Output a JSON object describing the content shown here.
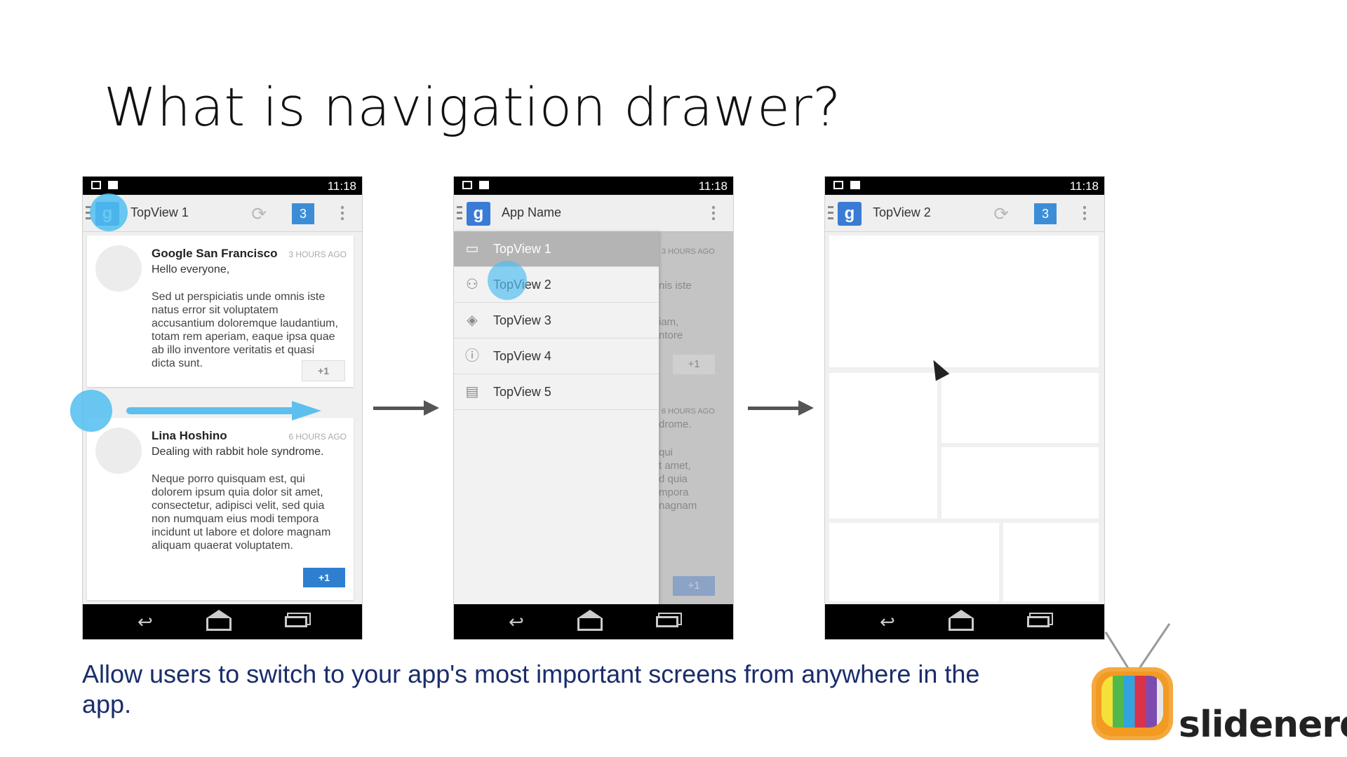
{
  "slide": {
    "title": "What is navigation drawer?",
    "caption": "Allow users to switch to your app's most important screens from anywhere in the app.",
    "brand": "slidenerd"
  },
  "status_time": "11:18",
  "screen1": {
    "title": "TopView 1",
    "badge": "3",
    "posts": [
      {
        "name": "Google San Francisco",
        "time": "3 HOURS AGO",
        "lead": "Hello everyone,",
        "body": "Sed ut perspiciatis unde omnis iste natus error sit voluptatem accusantium doloremque laudantium, totam rem aperiam, eaque ipsa quae ab illo inventore veritatis et quasi dicta sunt.",
        "plus": "+1"
      },
      {
        "name": "Lina Hoshino",
        "time": "6 HOURS AGO",
        "lead": "Dealing with rabbit hole syndrome.",
        "body": "Neque porro quisquam est, qui dolorem ipsum quia dolor sit amet, consectetur, adipisci velit, sed quia non numquam eius modi tempora incidunt ut labore et dolore magnam aliquam quaerat voluptatem.",
        "plus": "+1"
      }
    ]
  },
  "screen2": {
    "title": "App Name",
    "drawer_items": [
      {
        "label": "TopView 1",
        "icon": "inbox-icon"
      },
      {
        "label": "TopView 2",
        "icon": "people-icon"
      },
      {
        "label": "TopView 3",
        "icon": "tag-icon"
      },
      {
        "label": "TopView 4",
        "icon": "info-icon"
      },
      {
        "label": "TopView 5",
        "icon": "chat-icon"
      }
    ],
    "peek": {
      "t1": "3 HOURS AGO",
      "t2": "nis iste",
      "t3": "iam,\nntore",
      "t4": "+1",
      "t5": "6 HOURS AGO",
      "t6": "drome.",
      "t7": "qui\nt amet,\nd quia\nmpora\nnagnam",
      "t8": "+1"
    }
  },
  "screen3": {
    "title": "TopView 2",
    "badge": "3"
  }
}
